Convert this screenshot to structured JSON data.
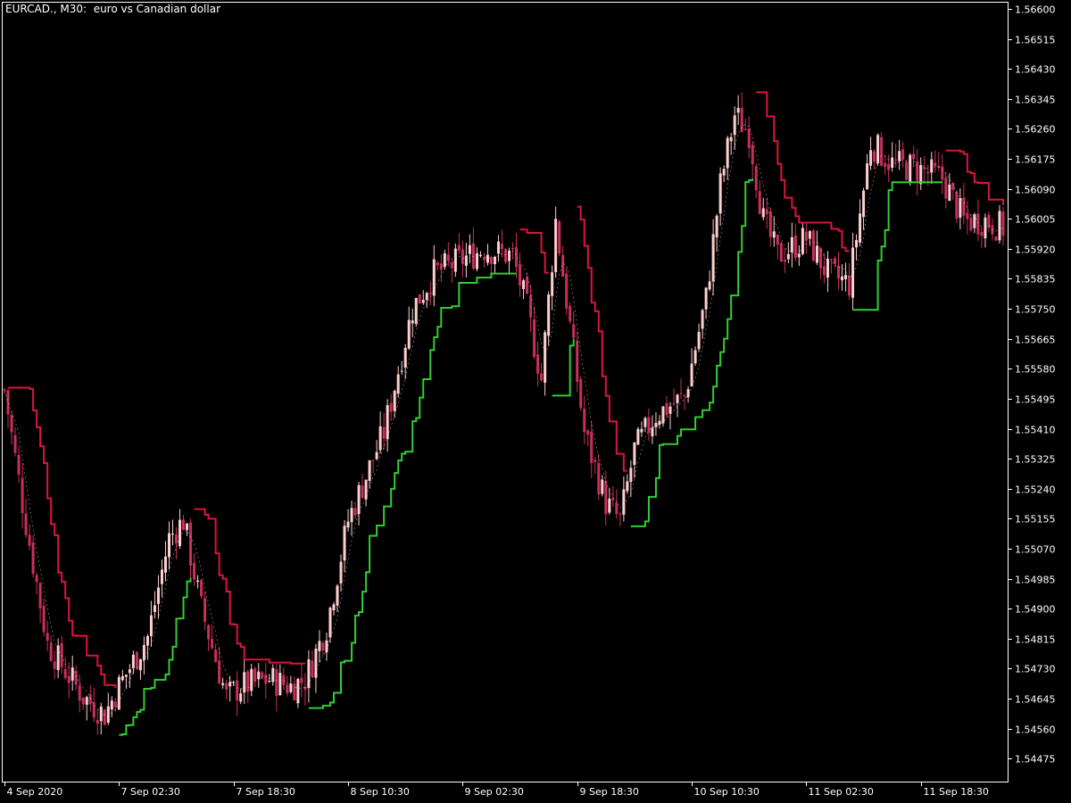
{
  "header": {
    "symbol": "EURCAD., M30:",
    "description": "euro vs Canadian dollar"
  },
  "colors": {
    "background": "#000000",
    "axis": "#ffffff",
    "bull_candle": "#ffcfcf",
    "bear_candle": "#c8305c",
    "up_line": "#32cd32",
    "down_line": "#dc143c",
    "signal_line": "#ffffff"
  },
  "chart_data": {
    "type": "candlestick",
    "y_axis": {
      "min": 1.5441,
      "max": 1.5662,
      "ticks": [
        "1.56600",
        "1.56515",
        "1.56430",
        "1.56345",
        "1.56260",
        "1.56175",
        "1.56090",
        "1.56005",
        "1.55920",
        "1.55835",
        "1.55750",
        "1.55665",
        "1.55580",
        "1.55495",
        "1.55410",
        "1.55325",
        "1.55240",
        "1.55155",
        "1.55070",
        "1.54985",
        "1.54900",
        "1.54815",
        "1.54730",
        "1.54645",
        "1.54560",
        "1.54475"
      ]
    },
    "x_axis": {
      "bars": 280,
      "labels": [
        {
          "text": "4 Sep 2020",
          "bar": 0
        },
        {
          "text": "7 Sep 02:30",
          "bar": 32
        },
        {
          "text": "7 Sep 18:30",
          "bar": 64
        },
        {
          "text": "8 Sep 10:30",
          "bar": 96
        },
        {
          "text": "9 Sep 02:30",
          "bar": 128
        },
        {
          "text": "9 Sep 18:30",
          "bar": 160
        },
        {
          "text": "10 Sep 10:30",
          "bar": 192
        },
        {
          "text": "11 Sep 02:30",
          "bar": 224
        },
        {
          "text": "11 Sep 18:30",
          "bar": 256
        }
      ]
    },
    "price_path": [
      [
        0,
        1.5552
      ],
      [
        5,
        1.552
      ],
      [
        12,
        1.548
      ],
      [
        22,
        1.5465
      ],
      [
        28,
        1.546
      ],
      [
        32,
        1.5468
      ],
      [
        40,
        1.5482
      ],
      [
        46,
        1.551
      ],
      [
        50,
        1.5515
      ],
      [
        55,
        1.549
      ],
      [
        62,
        1.5465
      ],
      [
        66,
        1.5468
      ],
      [
        74,
        1.547
      ],
      [
        80,
        1.5468
      ],
      [
        84,
        1.547
      ],
      [
        90,
        1.5485
      ],
      [
        96,
        1.5515
      ],
      [
        106,
        1.554
      ],
      [
        114,
        1.5575
      ],
      [
        120,
        1.5585
      ],
      [
        126,
        1.5588
      ],
      [
        134,
        1.5592
      ],
      [
        142,
        1.559
      ],
      [
        146,
        1.5575
      ],
      [
        150,
        1.5555
      ],
      [
        154,
        1.56
      ],
      [
        158,
        1.557
      ],
      [
        162,
        1.554
      ],
      [
        168,
        1.552
      ],
      [
        172,
        1.5515
      ],
      [
        176,
        1.5535
      ],
      [
        182,
        1.5545
      ],
      [
        190,
        1.555
      ],
      [
        196,
        1.5578
      ],
      [
        200,
        1.561
      ],
      [
        204,
        1.563
      ],
      [
        208,
        1.5625
      ],
      [
        212,
        1.56
      ],
      [
        216,
        1.559
      ],
      [
        224,
        1.5595
      ],
      [
        230,
        1.5585
      ],
      [
        236,
        1.5582
      ],
      [
        242,
        1.5622
      ],
      [
        248,
        1.5616
      ],
      [
        254,
        1.5615
      ],
      [
        262,
        1.5612
      ],
      [
        268,
        1.56
      ],
      [
        274,
        1.56
      ],
      [
        279,
        1.5598
      ]
    ]
  }
}
